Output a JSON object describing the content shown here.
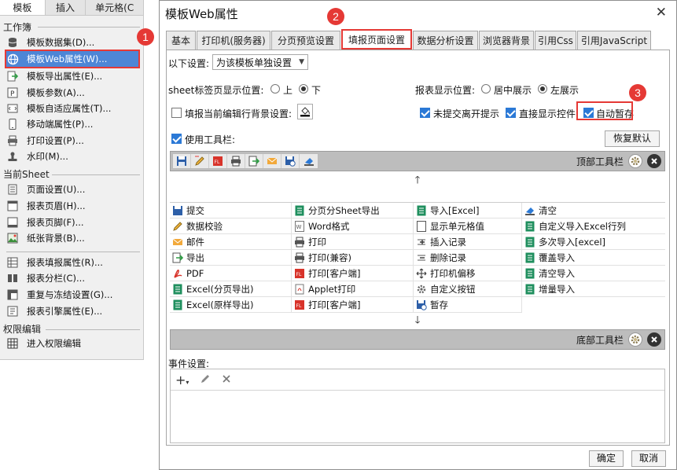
{
  "left_menu": {
    "tabs": [
      "模板",
      "插入",
      "单元格(C"
    ],
    "section_workbook": "工作簿",
    "workbook_items": [
      {
        "label": "模板数据集(D)...",
        "icon": "database-icon"
      },
      {
        "label": "模板Web属性(W)...",
        "icon": "globe-settings-icon"
      },
      {
        "label": "模板导出属性(E)...",
        "icon": "export-icon"
      },
      {
        "label": "模板参数(A)...",
        "icon": "parameter-icon"
      },
      {
        "label": "模板自适应属性(T)...",
        "icon": "adaptive-icon"
      },
      {
        "label": "移动端属性(P)...",
        "icon": "mobile-icon"
      },
      {
        "label": "打印设置(P)...",
        "icon": "printer-icon"
      },
      {
        "label": "水印(M)...",
        "icon": "watermark-icon"
      }
    ],
    "section_sheet": "当前Sheet",
    "sheet_items": [
      {
        "label": "页面设置(U)...",
        "icon": "page-setup-icon"
      },
      {
        "label": "报表页眉(H)...",
        "icon": "header-icon"
      },
      {
        "label": "报表页脚(F)...",
        "icon": "footer-icon"
      },
      {
        "label": "纸张背景(B)...",
        "icon": "background-icon"
      },
      {
        "label": "报表填报属性(R)...",
        "icon": "fill-property-icon"
      },
      {
        "label": "报表分栏(C)...",
        "icon": "columns-icon"
      },
      {
        "label": "重复与冻结设置(G)...",
        "icon": "freeze-icon"
      },
      {
        "label": "报表引擎属性(E)...",
        "icon": "engine-icon"
      }
    ],
    "section_permission": "权限编辑",
    "permission_items": [
      {
        "label": "进入权限编辑",
        "icon": "permission-grid-icon"
      }
    ]
  },
  "dialog": {
    "title": "模板Web属性",
    "tabs": [
      "基本",
      "打印机(服务器)",
      "分页预览设置",
      "填报页面设置",
      "数据分析设置",
      "浏览器背景",
      "引用Css",
      "引用JavaScript"
    ],
    "active_tab": "填报页面设置",
    "settings_label": "以下设置:",
    "settings_value": "为该模板单独设置",
    "sheet_tab_pos_label": "sheet标签页显示位置:",
    "sheet_tab_pos_options": [
      "上",
      "下"
    ],
    "sheet_tab_pos_selected": "下",
    "report_pos_label": "报表显示位置:",
    "report_pos_options": [
      "居中展示",
      "左展示"
    ],
    "report_pos_selected": "左展示",
    "bg_setting_label": "填报当前编辑行背景设置:",
    "bg_setting_checked": false,
    "unsubmitted_label": "未提交离开提示",
    "unsubmitted_checked": true,
    "direct_show_label": "直接显示控件",
    "direct_show_checked": true,
    "autosave_label": "自动暂存",
    "autosave_checked": true,
    "use_toolbar_label": "使用工具栏:",
    "use_toolbar_checked": true,
    "restore_default": "恢复默认",
    "top_toolbar_label": "顶部工具栏",
    "bottom_toolbar_label": "底部工具栏",
    "toolbar_buttons": [
      "save-icon",
      "edit-icon",
      "pdf-export-icon",
      "print-icon",
      "export-icon",
      "mail-icon",
      "schedule-save-icon",
      "clear-icon"
    ],
    "button_list": [
      [
        "提交",
        "分页分Sheet导出",
        "导入[Excel]",
        "清空"
      ],
      [
        "数据校验",
        "Word格式",
        "显示单元格值",
        "自定义导入Excel行列"
      ],
      [
        "邮件",
        "打印",
        "插入记录",
        "多次导入[excel]"
      ],
      [
        "导出",
        "打印(兼容)",
        "删除记录",
        "覆盖导入"
      ],
      [
        "PDF",
        "打印[客户端]",
        "打印机偏移",
        "清空导入"
      ],
      [
        "Excel(分页导出)",
        "Applet打印",
        "自定义按钮",
        "增量导入"
      ],
      [
        "Excel(原样导出)",
        "打印[客户端]",
        "暂存",
        ""
      ]
    ],
    "event_label": "事件设置:",
    "ok": "确定",
    "cancel": "取消"
  },
  "callouts": [
    "1",
    "2",
    "3"
  ],
  "colors": {
    "callout": "#e53935",
    "selection": "#4d86d6",
    "checkbox": "#2b79d6"
  }
}
